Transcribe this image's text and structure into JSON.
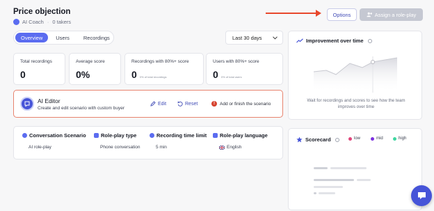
{
  "header": {
    "title": "Price objection",
    "coach": "AI Coach",
    "takers": "0 takers",
    "options_label": "Options",
    "assign_label": "Assign a role-play"
  },
  "tabs": [
    {
      "label": "Overview",
      "active": true
    },
    {
      "label": "Users",
      "active": false
    },
    {
      "label": "Recordings",
      "active": false
    }
  ],
  "date_filter": {
    "value": "Last 30 days"
  },
  "stats": [
    {
      "label": "Total recordings",
      "value": "0",
      "sub": ""
    },
    {
      "label": "Average score",
      "value": "0%",
      "sub": ""
    },
    {
      "label": "Recordings with 80%+ score",
      "value": "0",
      "sub": "0% of total recordings"
    },
    {
      "label": "Users with 80%+ score",
      "value": "0",
      "sub": "0% of total users"
    }
  ],
  "editor": {
    "title": "AI Editor",
    "description": "Create and edit scenario with custom buyer",
    "edit_label": "Edit",
    "reset_label": "Reset",
    "warning": "Add or finish the scenario"
  },
  "config": [
    {
      "heading": "Conversation Scenario",
      "value": "AI role-play"
    },
    {
      "heading": "Role-play type",
      "value": "Phone conversation"
    },
    {
      "heading": "Recording time limit",
      "value": "5 min"
    },
    {
      "heading": "Role-play language",
      "value": "English"
    }
  ],
  "improvement": {
    "title": "Improvement over time",
    "message": "Wait for recordings and scores to see how the team improves over time"
  },
  "scorecard": {
    "title": "Scorecard",
    "legend": [
      {
        "label": "low",
        "color": "#e0457b"
      },
      {
        "label": "mid",
        "color": "#7b2fe0"
      },
      {
        "label": "high",
        "color": "#3ed6a0"
      }
    ]
  },
  "colors": {
    "accent": "#5b6cf0",
    "arrow": "#e8482c",
    "warning": "#d6422e"
  }
}
